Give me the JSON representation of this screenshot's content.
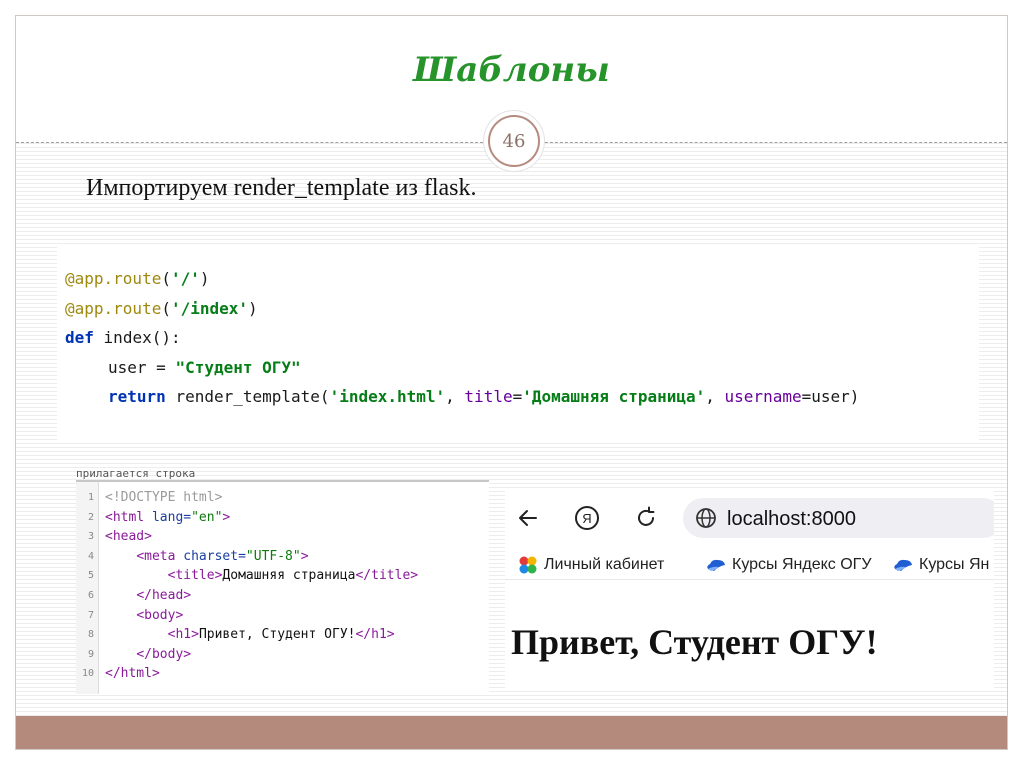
{
  "slide": {
    "title": "Шаблоны",
    "page_number": "46",
    "intro": "Импортируем render_template из flask."
  },
  "python_code": {
    "decorator1": "@app.route",
    "route1": "'/'",
    "decorator2": "@app.route",
    "route2": "'/index'",
    "def_kw": "def",
    "func_sig": "index():",
    "user_assign": "user = ",
    "user_value": "\"Студент ОГУ\"",
    "return_kw": "return",
    "render_call": "render_template(",
    "template_name": "'index.html'",
    "title_kw": "title",
    "title_value": "'Домашняя страница'",
    "username_kw": "username",
    "username_value": "=user)"
  },
  "html_code": {
    "top_strip": "прилагается строка",
    "line_numbers": [
      "1",
      "2",
      "3",
      "4",
      "5",
      "6",
      "7",
      "8",
      "9",
      "10"
    ],
    "lines": {
      "l1": "<!DOCTYPE html>",
      "l2_tag": "<html",
      "l2_attr": "lang=",
      "l2_val": "\"en\"",
      "l2_end": ">",
      "l3": "<head>",
      "l4_tag": "<meta",
      "l4_attr": "charset=",
      "l4_val": "\"UTF-8\"",
      "l4_end": ">",
      "l5_open": "<title>",
      "l5_text": "Домашняя страница",
      "l5_close": "</title>",
      "l6": "</head>",
      "l7": "<body>",
      "l8_open": "<h1>",
      "l8_text": "Привет, Студент ОГУ!",
      "l8_close": "</h1>",
      "l9": "</body>",
      "l10": "</html>"
    }
  },
  "browser": {
    "url": "localhost:8000",
    "bookmarks": [
      "Личный кабинет",
      "Курсы Яндекс ОГУ",
      "Курсы Ян"
    ],
    "page_heading": "Привет, Студент ОГУ!"
  }
}
